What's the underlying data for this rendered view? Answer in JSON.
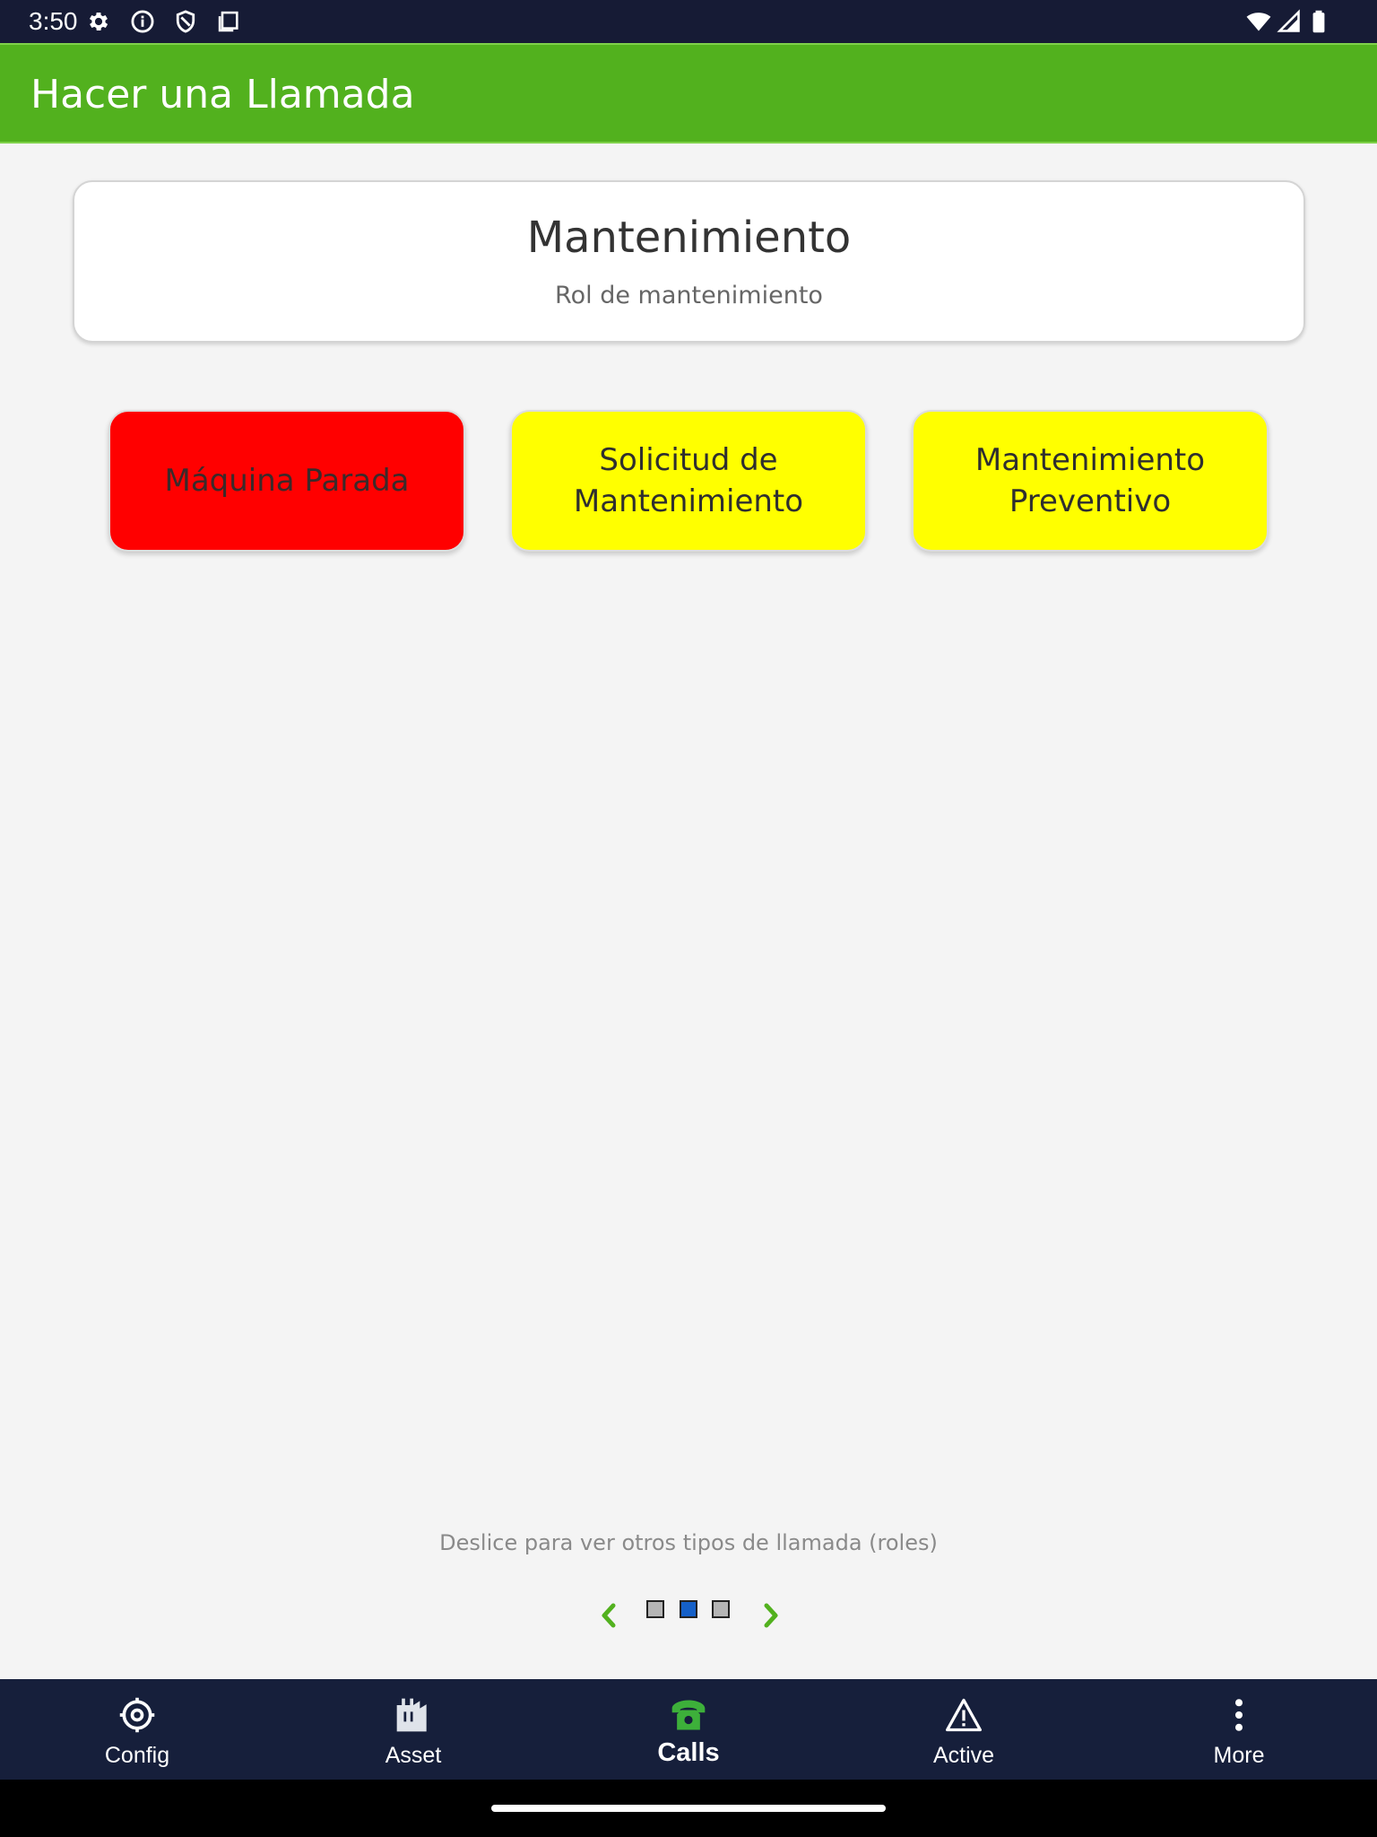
{
  "status_bar": {
    "time": "3:50",
    "left_icons": [
      "settings-gear-icon",
      "info-icon",
      "shield-icon",
      "clipboard-icon"
    ],
    "right_icons": [
      "wifi-icon",
      "signal-icon",
      "battery-icon"
    ]
  },
  "app_bar": {
    "title": "Hacer una Llamada"
  },
  "role": {
    "title": "Mantenimiento",
    "subtitle": "Rol de mantenimiento"
  },
  "call_types": [
    {
      "label": "Máquina Parada",
      "color": "#ff0000"
    },
    {
      "label": "Solicitud de Mantenimiento",
      "color": "#ffff00"
    },
    {
      "label": "Mantenimiento Preventivo",
      "color": "#ffff00"
    }
  ],
  "hint": "Deslice para ver otros tipos de llamada (roles)",
  "pager": {
    "total": 3,
    "current": 2,
    "prev_icon": "chevron-left-icon",
    "next_icon": "chevron-right-icon"
  },
  "bottom_nav": {
    "items": [
      {
        "label": "Config",
        "icon": "gear-icon"
      },
      {
        "label": "Asset",
        "icon": "factory-icon"
      },
      {
        "label": "Calls",
        "icon": "phone-icon",
        "active": true
      },
      {
        "label": "Active",
        "icon": "warning-icon"
      },
      {
        "label": "More",
        "icon": "more-vertical-icon"
      }
    ]
  },
  "colors": {
    "accent_green": "#52b11e",
    "status_bar": "#161b35",
    "bottom_nav": "#161f3b",
    "pager_active": "#1560c8"
  }
}
